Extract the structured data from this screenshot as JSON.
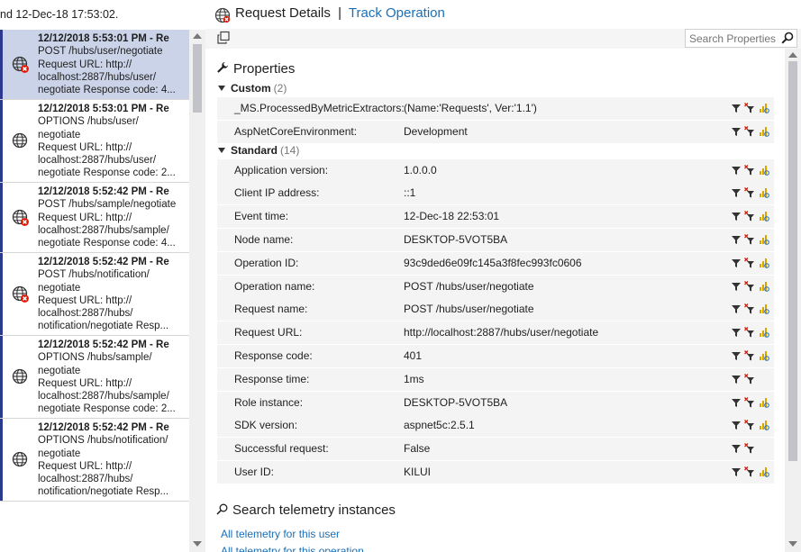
{
  "left_panel": {
    "status_text": "nd 12-Dec-18 17:53:02.",
    "items": [
      {
        "timestamp": "12/12/2018 5:53:01 PM - Re",
        "lines": [
          "POST /hubs/user/negotiate",
          "Request URL: http://",
          "localhost:2887/hubs/user/",
          "negotiate  Response code: 4..."
        ],
        "status": "error",
        "selected": true
      },
      {
        "timestamp": "12/12/2018 5:53:01 PM - Re",
        "lines": [
          "OPTIONS /hubs/user/",
          "negotiate",
          "Request URL: http://",
          "localhost:2887/hubs/user/",
          "negotiate  Response code: 2..."
        ],
        "status": "ok",
        "selected": false
      },
      {
        "timestamp": "12/12/2018 5:52:42 PM - Re",
        "lines": [
          "POST /hubs/sample/negotiate",
          "Request URL: http://",
          "localhost:2887/hubs/sample/",
          "negotiate  Response code: 4..."
        ],
        "status": "error",
        "selected": false
      },
      {
        "timestamp": "12/12/2018 5:52:42 PM - Re",
        "lines": [
          "POST /hubs/notification/",
          "negotiate",
          "Request URL: http://",
          "localhost:2887/hubs/",
          "notification/negotiate  Resp..."
        ],
        "status": "error",
        "selected": false
      },
      {
        "timestamp": "12/12/2018 5:52:42 PM - Re",
        "lines": [
          "OPTIONS /hubs/sample/",
          "negotiate",
          "Request URL: http://",
          "localhost:2887/hubs/sample/",
          "negotiate  Response code: 2..."
        ],
        "status": "ok",
        "selected": false
      },
      {
        "timestamp": "12/12/2018 5:52:42 PM - Re",
        "lines": [
          "OPTIONS /hubs/notification/",
          "negotiate",
          "Request URL: http://",
          "localhost:2887/hubs/",
          "notification/negotiate  Resp..."
        ],
        "status": "ok",
        "selected": false
      }
    ]
  },
  "header": {
    "title": "Request Details",
    "separator": "|",
    "track_link": "Track Operation"
  },
  "toolbar": {
    "search_placeholder": "Search Properties"
  },
  "properties": {
    "heading": "Properties",
    "groups": [
      {
        "name": "Custom",
        "count": "(2)",
        "rows": [
          {
            "key": "_MS.ProcessedByMetricExtractors:",
            "value": "(Name:'Requests', Ver:'1.1')",
            "has_chart": true
          },
          {
            "key": "AspNetCoreEnvironment:",
            "value": "Development",
            "has_chart": true
          }
        ]
      },
      {
        "name": "Standard",
        "count": "(14)",
        "rows": [
          {
            "key": "Application version:",
            "value": "1.0.0.0",
            "has_chart": true
          },
          {
            "key": "Client IP address:",
            "value": "::1",
            "has_chart": true
          },
          {
            "key": "Event time:",
            "value": "12-Dec-18 22:53:01",
            "has_chart": true
          },
          {
            "key": "Node name:",
            "value": "DESKTOP-5VOT5BA",
            "has_chart": true
          },
          {
            "key": "Operation ID:",
            "value": "93c9ded6e09fc145a3f8fec993fc0606",
            "has_chart": true
          },
          {
            "key": "Operation name:",
            "value": "POST /hubs/user/negotiate",
            "has_chart": true
          },
          {
            "key": "Request name:",
            "value": "POST /hubs/user/negotiate",
            "has_chart": true
          },
          {
            "key": "Request URL:",
            "value": "http://localhost:2887/hubs/user/negotiate",
            "has_chart": true
          },
          {
            "key": "Response code:",
            "value": "401",
            "has_chart": true
          },
          {
            "key": "Response time:",
            "value": "1ms",
            "has_chart": false
          },
          {
            "key": "Role instance:",
            "value": "DESKTOP-5VOT5BA",
            "has_chart": true
          },
          {
            "key": "SDK version:",
            "value": "aspnet5c:2.5.1",
            "has_chart": true
          },
          {
            "key": "Successful request:",
            "value": "False",
            "has_chart": false
          },
          {
            "key": "User ID:",
            "value": "KILUI",
            "has_chart": true
          }
        ]
      }
    ]
  },
  "search_telemetry": {
    "heading": "Search telemetry instances",
    "links": [
      "All telemetry for this user",
      "All telemetry for this operation"
    ]
  },
  "colors": {
    "link": "#1a6fb8",
    "selected_item": "#cbd3e8",
    "error_badge": "#e51400",
    "filter_icon": "#333333",
    "chart_icon": "#d9a300"
  }
}
